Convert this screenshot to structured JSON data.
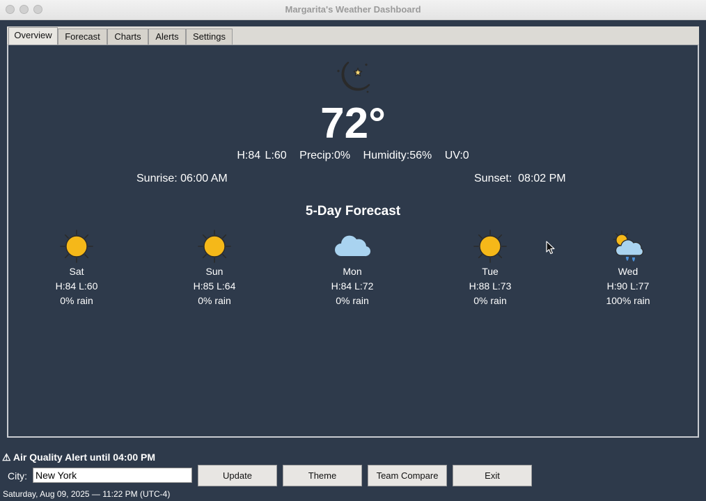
{
  "window": {
    "title": "Margarita's Weather Dashboard"
  },
  "tabs": [
    {
      "label": "Overview",
      "active": true
    },
    {
      "label": "Forecast",
      "active": false
    },
    {
      "label": "Charts",
      "active": false
    },
    {
      "label": "Alerts",
      "active": false
    },
    {
      "label": "Settings",
      "active": false
    }
  ],
  "current": {
    "icon": "crescent-moon-icon",
    "temperature": "72°",
    "high_low": "H:84 L:60",
    "precip": "Precip:0%",
    "humidity": "Humidity:56%",
    "uv": "UV:0",
    "sunrise": "Sunrise: 06:00 AM",
    "sunset": "Sunset:  08:02 PM"
  },
  "forecast": {
    "title": "5-Day Forecast",
    "days": [
      {
        "day": "Sat",
        "hilo": "H:84 L:60",
        "rain": "0% rain",
        "icon": "sun-icon"
      },
      {
        "day": "Sun",
        "hilo": "H:85 L:64",
        "rain": "0% rain",
        "icon": "sun-icon"
      },
      {
        "day": "Mon",
        "hilo": "H:84 L:72",
        "rain": "0% rain",
        "icon": "cloud-icon"
      },
      {
        "day": "Tue",
        "hilo": "H:88 L:73",
        "rain": "0% rain",
        "icon": "sun-icon"
      },
      {
        "day": "Wed",
        "hilo": "H:90 L:77",
        "rain": "100% rain",
        "icon": "sun-rain-cloud-icon"
      }
    ]
  },
  "alert": {
    "text": "⚠ Air Quality Alert until 04:00 PM"
  },
  "controls": {
    "city_label": "City:",
    "city_value": "New York",
    "buttons": [
      "Update",
      "Theme",
      "Team Compare",
      "Exit"
    ]
  },
  "footer": {
    "datetime": "Saturday, Aug 09, 2025 — 11:22 PM  (UTC-4)"
  },
  "colors": {
    "background": "#2e3a4b",
    "sun": "#f5b819",
    "moon": "#f7d774",
    "cloud": "#a9d3f0"
  }
}
